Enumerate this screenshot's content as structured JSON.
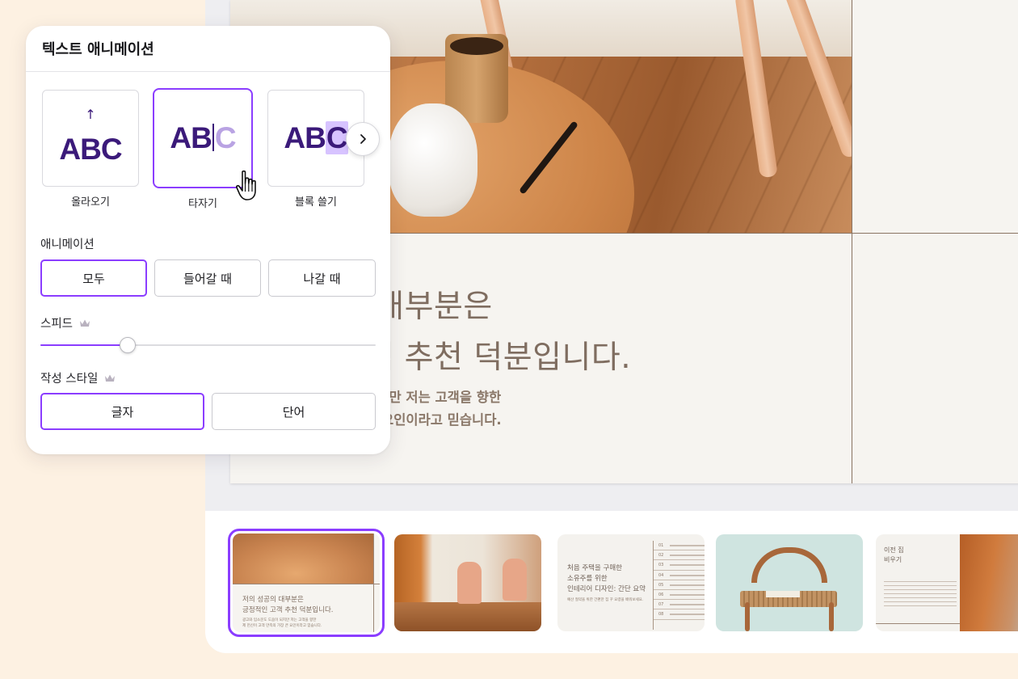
{
  "panel": {
    "title": "텍스트 애니메이션",
    "presets": [
      {
        "label": "올라오기",
        "preview": "ABC",
        "icon": "arrow-up-icon",
        "selected": false
      },
      {
        "label": "타자기",
        "preview_main": "AB",
        "preview_typed": "C",
        "selected": true
      },
      {
        "label": "블록 쓸기",
        "preview_main": "AB",
        "preview_highlight": "C",
        "selected": false
      }
    ],
    "next_icon": "chevron-right-icon",
    "animation": {
      "label": "애니메이션",
      "options": [
        "모두",
        "들어갈 때",
        "나갈 때"
      ],
      "selected": "모두"
    },
    "speed": {
      "label": "스피드",
      "premium_icon": "crown-icon",
      "value_fraction": 0.26
    },
    "writing_style": {
      "label": "작성 스타일",
      "premium_icon": "crown-icon",
      "options": [
        "글자",
        "단어"
      ],
      "selected": "글자"
    }
  },
  "slide": {
    "headline": "의 대부분은\n고객 추천 덕분입니다.",
    "body": "움이 되지만 저는 고객을 향한\n가장 큰 요인이라고 믿습니다."
  },
  "thumbnails": {
    "t1": {
      "title": "저의 성공의 대부분은\n긍정적인 고객 추천 덕분입니다.",
      "body": "광고와 입소문도 도움이 되지만 저는 고객을 향한\n제 헌신이 고객 만족의 가장 큰 요인이라고 믿습니다."
    },
    "t3": {
      "title": "처음 주택을 구매한\n소유주를 위한\n인테리어 디자인: 간단 요약",
      "subtitle": "예산 절약을 위한 간편한 집 꾸 요령을 배워보세요.",
      "rows": [
        "01",
        "02",
        "03",
        "04",
        "05",
        "06",
        "07",
        "08"
      ]
    },
    "t5": {
      "title": "이전 집\n비우기"
    }
  },
  "colors": {
    "accent": "#8b3dff",
    "preview_text": "#3b1a7a",
    "slide_text": "#7f6d60"
  }
}
